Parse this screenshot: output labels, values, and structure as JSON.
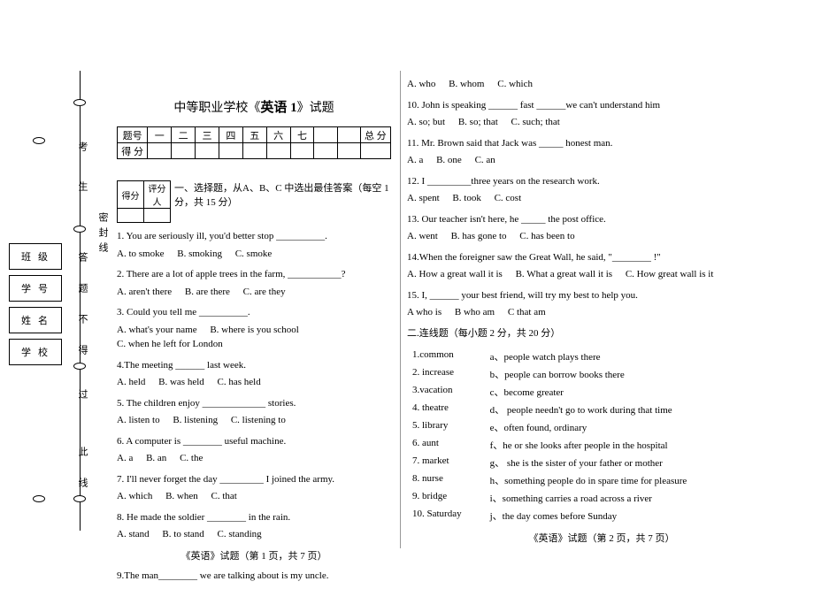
{
  "infoLabels": {
    "class": "班级",
    "number": "学号",
    "name": "姓名",
    "school": "学校"
  },
  "bindingChars": [
    "考",
    "生",
    "答",
    "题",
    "不",
    "得",
    "过",
    "此",
    "线"
  ],
  "bindingSeal": "密封线",
  "title_pre": "中等职业学校《",
  "title_bold": "英语 1",
  "title_post": "》试题",
  "scoreHeader": [
    "题号",
    "一",
    "二",
    "三",
    "四",
    "五",
    "六",
    "七",
    "",
    "",
    "总 分"
  ],
  "scoreRow2": "得 分",
  "miniH1": "得分",
  "miniH2": "评分人",
  "section1": "一、选择题，从A、B、C 中选出最佳答案（每空 1 分，共 15 分）",
  "q1": "1. You are seriously ill, you'd better stop __________.",
  "q1a": "A. to smoke",
  "q1b": "B. smoking",
  "q1c": "C. smoke",
  "q2": "2. There are a lot of apple trees in the farm, ___________?",
  "q2a": "A. aren't there",
  "q2b": "B. are there",
  "q2c": "C. are they",
  "q3": "3. Could you tell me __________.",
  "q3a": "A. what's your name",
  "q3b": "B. where is you school",
  "q3c": "C. when he left for London",
  "q4": "4.The meeting ______ last week.",
  "q4a": "A. held",
  "q4b": "B. was held",
  "q4c": "C. has held",
  "q5": "5. The children enjoy _____________ stories.",
  "q5a": "A. listen to",
  "q5b": "B. listening",
  "q5c": "C. listening to",
  "q6": "6. A computer is ________ useful machine.",
  "q6a": "A. a",
  "q6b": "B. an",
  "q6c": "C. the",
  "q7": "7. I'll never forget the day _________ I joined the army.",
  "q7a": "A. which",
  "q7b": "B. when",
  "q7c": "C. that",
  "q8": "8. He made the soldier ________ in the rain.",
  "q8a": "A. stand",
  "q8b": "B. to stand",
  "q8c": "C. standing",
  "footer1": "《英语》试题（第 1 页，共 7 页）",
  "q9": "9.The man________ we are talking about is my uncle.",
  "q9a": "A. who",
  "q9b": "B. whom",
  "q9c": "C. which",
  "q10": "10. John is speaking ______ fast ______we can't understand him",
  "q10a": "A. so; but",
  "q10b": "B. so; that",
  "q10c": "C. such; that",
  "q11": "11. Mr. Brown said that Jack was _____ honest man.",
  "q11a": "A. a",
  "q11b": "B. one",
  "q11c": "C. an",
  "q12": "12. I _________three years on the research work.",
  "q12a": "A. spent",
  "q12b": "B. took",
  "q12c": "C. cost",
  "q13": "13. Our teacher isn't here, he _____ the post office.",
  "q13a": "A. went",
  "q13b": "B. has gone to",
  "q13c": "C. has been to",
  "q14": "14.When the foreigner saw the Great Wall, he said, \"________ !\"",
  "q14a": "A. How a great wall it is",
  "q14b": "B. What a great wall it is",
  "q14c": "C. How great wall is it",
  "q15": "15. I, ______ your best friend, will try my best to help you.",
  "q15a": "A who is",
  "q15b": "B who am",
  "q15c": "C that am",
  "section2": "二.连线题（每小题 2 分，共 20 分）",
  "m1l": "1.common",
  "m1r": "a、people watch plays there",
  "m2l": "2. increase",
  "m2r": "b、people can borrow books there",
  "m3l": "3.vacation",
  "m3r": "c、become greater",
  "m4l": "4. theatre",
  "m4r": "d、 people needn't go to work during that time",
  "m5l": "5. library",
  "m5r": "e、often found, ordinary",
  "m6l": "6. aunt",
  "m6r": "f、he or she looks after people in the hospital",
  "m7l": "7. market",
  "m7r": "g、 she is the sister of your father or mother",
  "m8l": "8. nurse",
  "m8r": "h、something people do in spare time for pleasure",
  "m9l": "9. bridge",
  "m9r": "i、something carries a road across a river",
  "m10l": "10. Saturday",
  "m10r": "j、the day comes before Sunday",
  "footer2": "《英语》试题（第 2 页，共 7 页）"
}
